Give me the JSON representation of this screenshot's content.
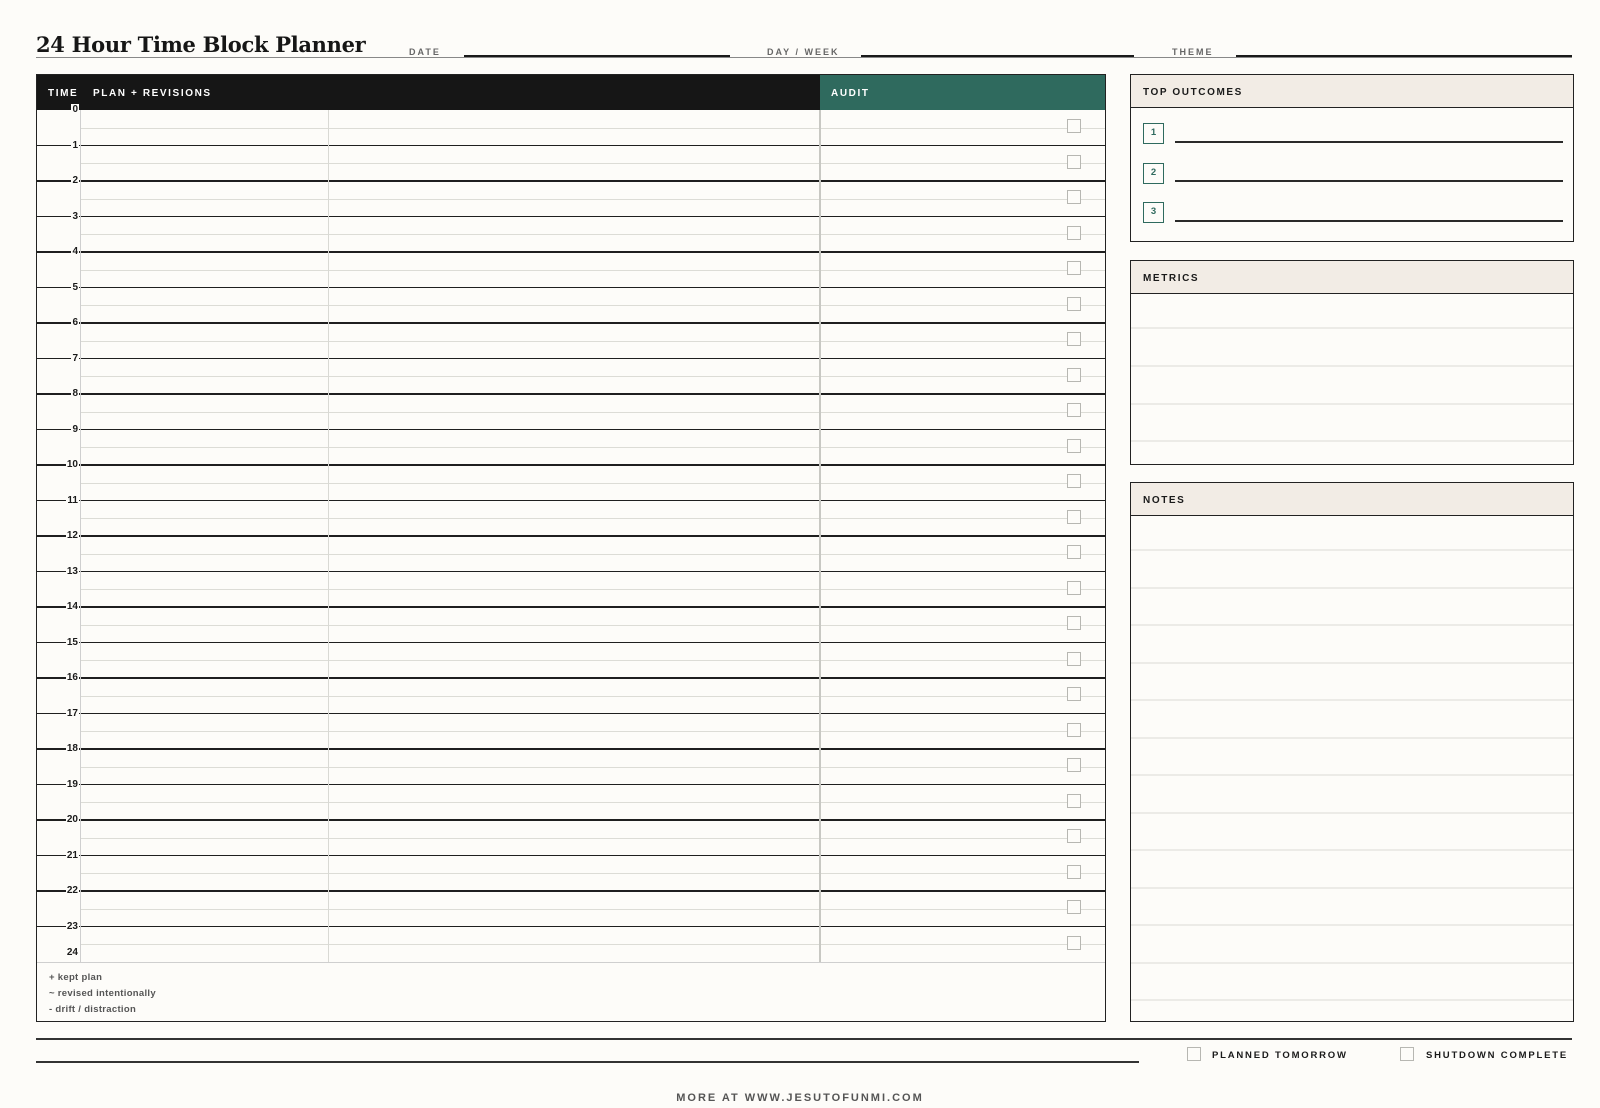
{
  "header": {
    "title": "24 Hour Time Block Planner",
    "fields": [
      "DATE",
      "DAY / WEEK",
      "THEME"
    ]
  },
  "grid": {
    "col_time": "TIME",
    "col_plan": "PLAN + REVISIONS",
    "col_audit": "AUDIT",
    "hours": [
      "0",
      "1",
      "2",
      "3",
      "4",
      "5",
      "6",
      "7",
      "8",
      "9",
      "10",
      "11",
      "12",
      "13",
      "14",
      "15",
      "16",
      "17",
      "18",
      "19",
      "20",
      "21",
      "22",
      "23",
      "24"
    ],
    "legend": [
      "+ kept plan",
      "~ revised intentionally",
      "- drift / distraction"
    ]
  },
  "panels": {
    "outcomes_title": "TOP OUTCOMES",
    "outcome_numbers": [
      "1",
      "2",
      "3"
    ],
    "metrics_title": "METRICS",
    "notes_title": "NOTES"
  },
  "footer": {
    "planned_tomorrow": "PLANNED TOMORROW",
    "shutdown_complete": "SHUTDOWN COMPLETE",
    "credit": "MORE AT WWW.JESUTOFUNMI.COM"
  },
  "colors": {
    "accent": "#2f6a5e",
    "header_dark": "#161616",
    "panel_header": "#f2ece5"
  }
}
